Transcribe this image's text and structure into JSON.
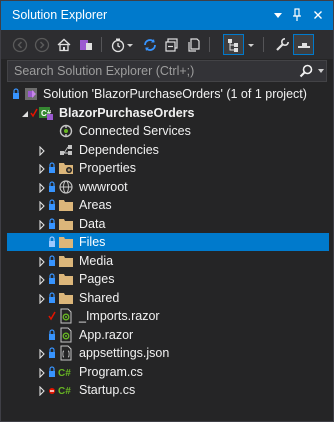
{
  "window": {
    "title": "Solution Explorer"
  },
  "title_buttons": {
    "dropdown_icon": "dropdown-arrow-icon",
    "pin_icon": "pin-icon",
    "close_icon": "close-icon"
  },
  "toolbar": {
    "buttons": [
      "back",
      "forward",
      "home",
      "switch-views",
      "pending-changes-filter",
      "sync",
      "collapse-all",
      "show-all-files",
      "preview-selected",
      "properties",
      "solution-view"
    ]
  },
  "search": {
    "placeholder": "Search Solution Explorer (Ctrl+;)",
    "value": ""
  },
  "tree": {
    "solution": {
      "label": "Solution 'BlazorPurchaseOrders' (1 of 1 project)"
    },
    "project": {
      "label": "BlazorPurchaseOrders"
    },
    "items": [
      {
        "label": "Connected Services",
        "icon": "connected-services-icon"
      },
      {
        "label": "Dependencies",
        "icon": "dependencies-icon"
      },
      {
        "label": "Properties",
        "icon": "properties-folder-icon"
      },
      {
        "label": "wwwroot",
        "icon": "globe-icon"
      },
      {
        "label": "Areas",
        "icon": "folder-icon"
      },
      {
        "label": "Data",
        "icon": "folder-icon"
      },
      {
        "label": "Files",
        "icon": "folder-icon",
        "selected": true
      },
      {
        "label": "Media",
        "icon": "folder-icon"
      },
      {
        "label": "Pages",
        "icon": "folder-icon"
      },
      {
        "label": "Shared",
        "icon": "folder-icon"
      },
      {
        "label": "_Imports.razor",
        "icon": "razor-file-icon"
      },
      {
        "label": "App.razor",
        "icon": "razor-file-icon"
      },
      {
        "label": "appsettings.json",
        "icon": "json-file-icon"
      },
      {
        "label": "Program.cs",
        "icon": "csharp-file-icon"
      },
      {
        "label": "Startup.cs",
        "icon": "csharp-file-icon"
      }
    ]
  },
  "colors": {
    "accent": "#007acc",
    "background": "#252526",
    "folder": "#dcb67a",
    "checkmark": "#e51400",
    "lock": "#3794ff",
    "csharp": "#68b723"
  }
}
